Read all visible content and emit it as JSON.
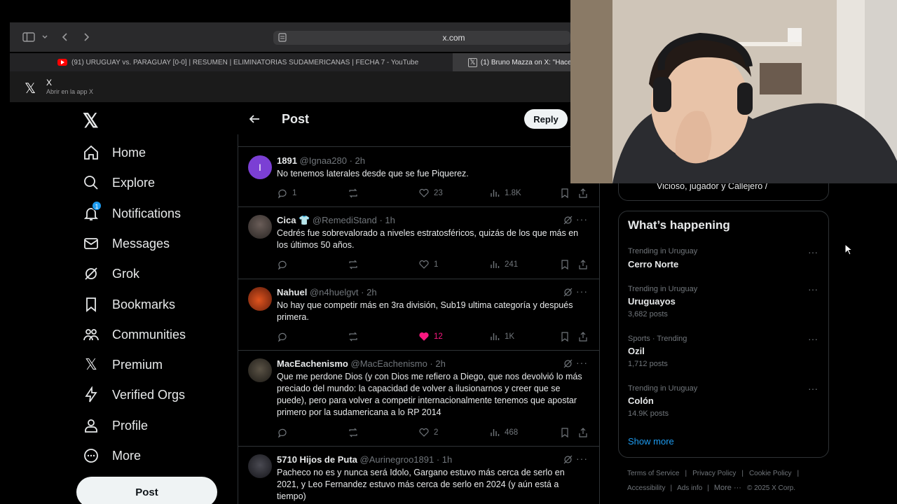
{
  "browser": {
    "url": "x.com",
    "tabs": [
      {
        "label": "(91) URUGUAY vs. PARAGUAY [0-0] | RESUMEN | ELIMINATORIAS SUDAMERICANAS | FECHA 7 - YouTube",
        "icon": "youtube-icon"
      },
      {
        "label": "(1) Bruno Mazza on X: \"Hace",
        "icon": "x-logo-icon"
      }
    ],
    "app_banner": {
      "title": "X",
      "subtitle": "Abrir en la app X"
    }
  },
  "nav": {
    "items": [
      {
        "label": "Home",
        "icon": "home-icon"
      },
      {
        "label": "Explore",
        "icon": "search-icon"
      },
      {
        "label": "Notifications",
        "icon": "bell-icon",
        "badge": "1"
      },
      {
        "label": "Messages",
        "icon": "mail-icon"
      },
      {
        "label": "Grok",
        "icon": "grok-icon"
      },
      {
        "label": "Bookmarks",
        "icon": "bookmark-icon"
      },
      {
        "label": "Communities",
        "icon": "communities-icon"
      },
      {
        "label": "Premium",
        "icon": "x-logo-icon"
      },
      {
        "label": "Verified Orgs",
        "icon": "lightning-icon"
      },
      {
        "label": "Profile",
        "icon": "person-icon"
      },
      {
        "label": "More",
        "icon": "more-circle-icon"
      }
    ],
    "post_label": "Post"
  },
  "header": {
    "title": "Post",
    "reply_label": "Reply"
  },
  "tweets": [
    {
      "name": "1891",
      "handle": "@Ignaa280 · 2h",
      "avatar_initial": "I",
      "avatar_color": "#7b3fd4",
      "text": "No tenemos laterales desde que se fue Piquerez.",
      "replies": "1",
      "retweets": "",
      "likes": "23",
      "views": "1.8K",
      "liked": false
    },
    {
      "name": "Cica 👕",
      "handle": "@RemediStand · 1h",
      "text": "Cedrés fue sobrevalorado a niveles estratosféricos, quizás de los que más en los últimos 50 años.",
      "replies": "",
      "retweets": "",
      "likes": "1",
      "views": "241",
      "liked": false
    },
    {
      "name": "Nahuel",
      "handle": "@n4huelgvt · 2h",
      "text": "No hay que competir más en 3ra división, Sub19 ultima categoría y después primera.",
      "replies": "",
      "retweets": "",
      "likes": "12",
      "views": "1K",
      "liked": true
    },
    {
      "name": "MacEachenismo",
      "handle": "@MacEachenismo · 2h",
      "text": "Que me perdone Dios (y con Dios me refiero a Diego, que nos devolvió lo más preciado del mundo: la capacidad de volver a ilusionarnos y creer que se puede), pero para volver a competir internacionalmente tenemos que apostar primero por la sudamericana a lo RP 2014",
      "replies": "",
      "retweets": "",
      "likes": "2",
      "views": "468",
      "liked": false
    },
    {
      "name": "5710 Hijos de Puta",
      "handle": "@Aurinegroo1891 · 1h",
      "text": "Pacheco no es y nunca será Idolo, Gargano estuvo más cerca de serlo en 2021, y Leo Fernandez estuvo más cerca de serlo en 2024 (y aún está a tiempo)"
    }
  ],
  "previous_card_text": "Vicioso, jugador y Callejero /",
  "happening": {
    "title": "What’s happening",
    "trends": [
      {
        "category": "Trending in Uruguay",
        "name": "Cerro Norte",
        "count": ""
      },
      {
        "category": "Trending in Uruguay",
        "name": "Uruguayos",
        "count": "3,682 posts"
      },
      {
        "category": "Sports · Trending",
        "name": "Ozil",
        "count": "1,712 posts"
      },
      {
        "category": "Trending in Uruguay",
        "name": "Colón",
        "count": "14.9K posts"
      }
    ],
    "show_more": "Show more"
  },
  "footer": {
    "links": [
      "Terms of Service",
      "Privacy Policy",
      "Cookie Policy",
      "Accessibility",
      "Ads info",
      "More ···"
    ],
    "copyright": "© 2025 X Corp."
  },
  "colors": {
    "like": "#f91880",
    "link": "#1d9bf0",
    "badge": "#1d9bf0"
  }
}
